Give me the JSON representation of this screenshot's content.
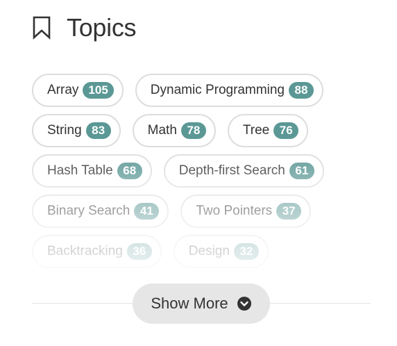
{
  "header": {
    "title": "Topics",
    "icon": "bookmark-icon"
  },
  "tags": [
    {
      "name": "Array",
      "count": "105"
    },
    {
      "name": "Dynamic Programming",
      "count": "88"
    },
    {
      "name": "String",
      "count": "83"
    },
    {
      "name": "Math",
      "count": "78"
    },
    {
      "name": "Tree",
      "count": "76"
    },
    {
      "name": "Hash Table",
      "count": "68"
    },
    {
      "name": "Depth-first Search",
      "count": "61"
    },
    {
      "name": "Binary Search",
      "count": "41"
    },
    {
      "name": "Two Pointers",
      "count": "37"
    },
    {
      "name": "Backtracking",
      "count": "36"
    },
    {
      "name": "Design",
      "count": "32"
    }
  ],
  "footer": {
    "show_more_label": "Show More",
    "icon": "chevron-down-icon"
  },
  "colors": {
    "badge": "#5b9895",
    "border": "#dddddd",
    "text": "#333333",
    "button_bg": "#e6e6e6"
  }
}
